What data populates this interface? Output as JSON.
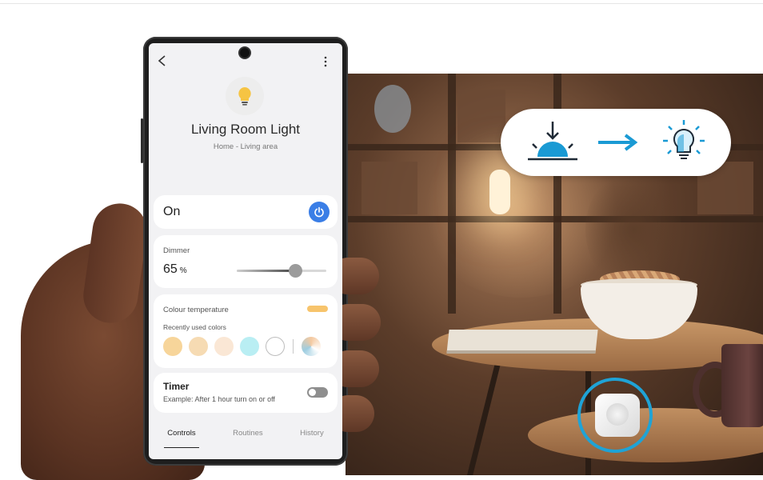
{
  "device": {
    "name": "Living Room Light",
    "location": "Home - Living area"
  },
  "power": {
    "label": "On",
    "state": true
  },
  "dimmer": {
    "label": "Dimmer",
    "value": "65",
    "unit": "%",
    "level": 0.65
  },
  "colour": {
    "label": "Colour temperature",
    "recent_label": "Recently used colors",
    "current_color": "#f7c46c",
    "swatches": [
      "#f7d59a",
      "#f6dbb3",
      "#fae7d5",
      "#b9eef3",
      "#ffffff"
    ]
  },
  "timer": {
    "title": "Timer",
    "description": "Example: After 1 hour turn on or off",
    "enabled": false
  },
  "tabs": [
    {
      "label": "Controls",
      "active": true
    },
    {
      "label": "Routines",
      "active": false
    },
    {
      "label": "History",
      "active": false
    }
  ],
  "icons": {
    "back": "back-arrow-icon",
    "more": "more-vertical-icon",
    "bulb": "light-bulb-icon",
    "power": "power-icon",
    "motion_sensor": "motion-sensor-icon",
    "arrow": "arrow-right-icon",
    "light_on": "light-on-icon"
  },
  "colors": {
    "accent": "#3a7ee6",
    "overlay_blue": "#1fa3d6"
  }
}
